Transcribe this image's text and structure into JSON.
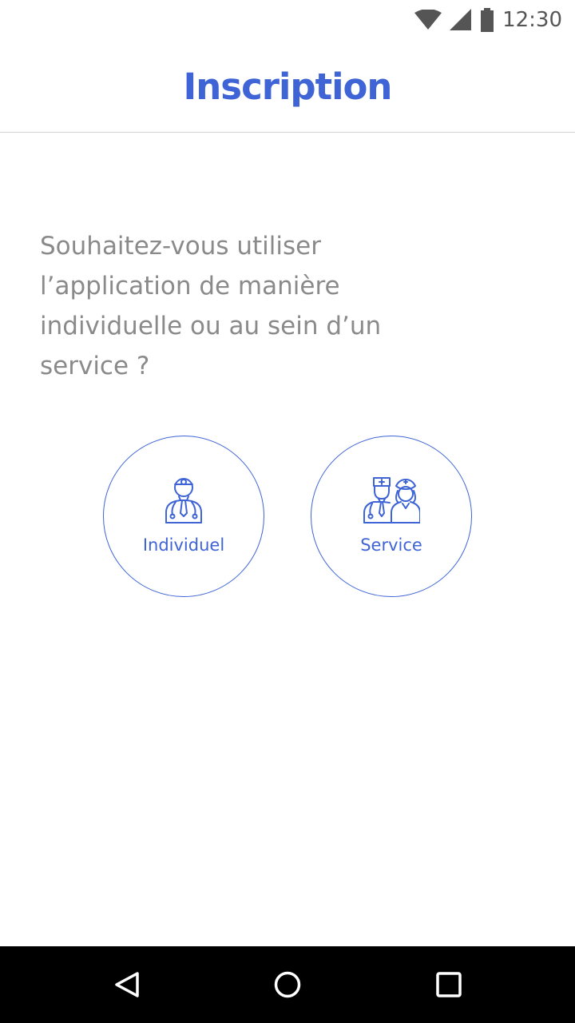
{
  "status_bar": {
    "time": "12:30",
    "icons": [
      "wifi-icon",
      "signal-icon",
      "battery-icon"
    ]
  },
  "header": {
    "title": "Inscription"
  },
  "question": {
    "text": "Souhaitez-vous utiliser l’application de manière individuelle ou au sein d’un service ?"
  },
  "choices": [
    {
      "label": "Individuel",
      "icon": "doctor-icon"
    },
    {
      "label": "Service",
      "icon": "medical-team-icon"
    }
  ],
  "nav_bar": {
    "buttons": [
      "back-icon",
      "home-icon",
      "recent-apps-icon"
    ]
  },
  "colors": {
    "accent": "#3e64d6",
    "question_text": "#8a8a8a",
    "divider": "#d3d3d3",
    "nav_background": "#000000"
  }
}
